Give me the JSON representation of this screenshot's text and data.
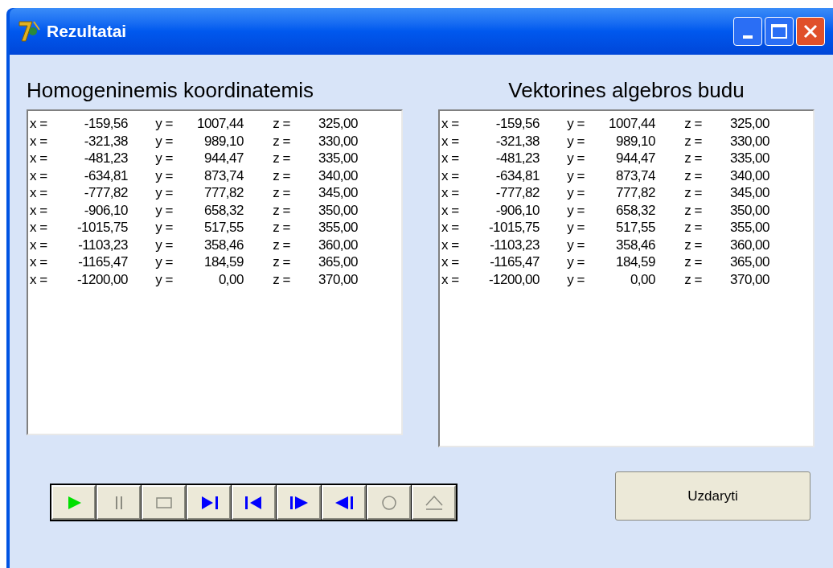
{
  "window": {
    "title": "Rezultatai"
  },
  "panels": [
    {
      "heading": "Homogeninemis koordinatemis",
      "lines": [
        [
          "x =",
          "-159,56",
          "y =",
          "1007,44",
          "z =",
          "325,00"
        ],
        [
          "x =",
          "-321,38",
          "y =",
          "989,10",
          "z =",
          "330,00"
        ],
        [
          "x =",
          "-481,23",
          "y =",
          "944,47",
          "z =",
          "335,00"
        ],
        [
          "x =",
          "-634,81",
          "y =",
          "873,74",
          "z =",
          "340,00"
        ],
        [
          "x =",
          "-777,82",
          "y =",
          "777,82",
          "z =",
          "345,00"
        ],
        [
          "x =",
          "-906,10",
          "y =",
          "658,32",
          "z =",
          "350,00"
        ],
        [
          "x =",
          "-1015,75",
          "y =",
          "517,55",
          "z =",
          "355,00"
        ],
        [
          "x =",
          "-1103,23",
          "y =",
          "358,46",
          "z =",
          "360,00"
        ],
        [
          "x =",
          "-1165,47",
          "y =",
          "184,59",
          "z =",
          "365,00"
        ],
        [
          "x =",
          "-1200,00",
          "y =",
          "0,00",
          "z =",
          "370,00"
        ]
      ]
    },
    {
      "heading": "Vektorines algebros budu",
      "lines": [
        [
          "x =",
          "-159,56",
          "y =",
          "1007,44",
          "z =",
          "325,00"
        ],
        [
          "x =",
          "-321,38",
          "y =",
          "989,10",
          "z =",
          "330,00"
        ],
        [
          "x =",
          "-481,23",
          "y =",
          "944,47",
          "z =",
          "335,00"
        ],
        [
          "x =",
          "-634,81",
          "y =",
          "873,74",
          "z =",
          "340,00"
        ],
        [
          "x =",
          "-777,82",
          "y =",
          "777,82",
          "z =",
          "345,00"
        ],
        [
          "x =",
          "-906,10",
          "y =",
          "658,32",
          "z =",
          "350,00"
        ],
        [
          "x =",
          "-1015,75",
          "y =",
          "517,55",
          "z =",
          "355,00"
        ],
        [
          "x =",
          "-1103,23",
          "y =",
          "358,46",
          "z =",
          "360,00"
        ],
        [
          "x =",
          "-1165,47",
          "y =",
          "184,59",
          "z =",
          "365,00"
        ],
        [
          "x =",
          "-1200,00",
          "y =",
          "0,00",
          "z =",
          "370,00"
        ]
      ]
    }
  ],
  "media_buttons": [
    {
      "kind": "play",
      "disabled": false
    },
    {
      "kind": "pause",
      "disabled": true
    },
    {
      "kind": "stop",
      "disabled": true
    },
    {
      "kind": "next",
      "disabled": false
    },
    {
      "kind": "prev",
      "disabled": false
    },
    {
      "kind": "step",
      "disabled": false
    },
    {
      "kind": "back",
      "disabled": false
    },
    {
      "kind": "record",
      "disabled": true
    },
    {
      "kind": "eject",
      "disabled": true
    }
  ],
  "close_button": "Uzdaryti"
}
